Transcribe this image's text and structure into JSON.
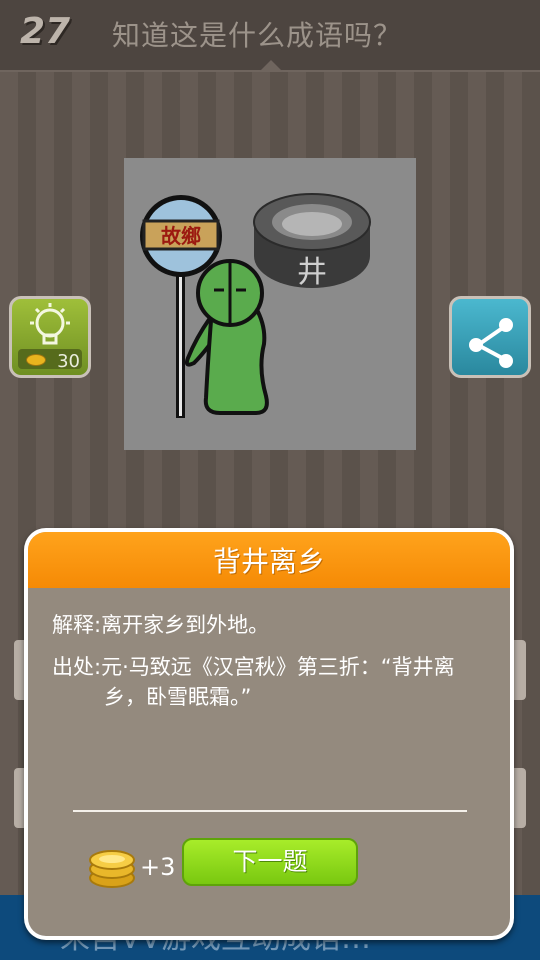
{
  "header": {
    "level": "27",
    "question": "知道这是什么成语吗？"
  },
  "puzzle": {
    "sign_text": "故鄉",
    "well_text": "井"
  },
  "hint_button": {
    "icon": "lightbulb-icon",
    "cost": "30",
    "color": "#8fb030"
  },
  "share_button": {
    "icon": "share-icon",
    "color": "#3aa7bf"
  },
  "background_banner": {
    "text": "来自VV游戏互动成语…"
  },
  "dialog": {
    "title": "背井离乡",
    "meaning_label": "解释:",
    "meaning": "离开家乡到外地。",
    "source_label": "出处:",
    "source": "元·马致远《汉宫秋》第三折：“背井离乡，卧雪眠霜。”",
    "reward": "+3",
    "next_label": "下一题",
    "title_color": "#f9960f",
    "button_color": "#8fdc1c"
  }
}
